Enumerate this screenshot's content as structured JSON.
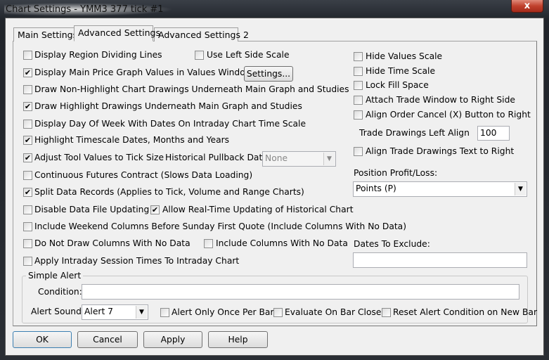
{
  "window": {
    "title": "Chart Settings - YMM3  377 tick  #1",
    "close": "x"
  },
  "tabs": [
    {
      "label": "Main Settings",
      "active": false
    },
    {
      "label": "Advanced Settings",
      "active": true
    },
    {
      "label": "Advanced Settings 2",
      "active": false
    }
  ],
  "left_options": [
    {
      "label": "Display Region Dividing Lines",
      "checked": false
    },
    {
      "label": "Display Main Price Graph Values in Values Windows",
      "checked": true
    },
    {
      "label": "Draw Non-Highlight Chart Drawings Underneath Main Graph and Studies",
      "checked": false
    },
    {
      "label": "Draw Highlight Drawings Underneath Main Graph and Studies",
      "checked": true
    },
    {
      "label": "Display Day Of Week With Dates On Intraday Chart Time Scale",
      "checked": false
    },
    {
      "label": "Highlight Timescale Dates, Months and Years",
      "checked": true
    },
    {
      "label": "Adjust Tool Values to Tick Size",
      "checked": true
    },
    {
      "label": "Continuous Futures Contract (Slows Data Loading)",
      "checked": false
    },
    {
      "label": "Split Data Records (Applies to Tick, Volume and Range Charts)",
      "checked": true
    },
    {
      "label": "Disable Data File Updating",
      "checked": false
    },
    {
      "label": "Include Weekend Columns Before Sunday First Quote (Include Columns With No Data)",
      "checked": false
    },
    {
      "label": "Do Not Draw Columns With No Data",
      "checked": false
    },
    {
      "label": "Apply Intraday Session Times To Intraday Chart",
      "checked": false
    }
  ],
  "use_left_side_scale": {
    "label": "Use Left Side Scale",
    "checked": false
  },
  "settings_button": "Settings...",
  "historical_pullback": {
    "label": "Historical Pullback Data:",
    "value": "None",
    "disabled": true
  },
  "allow_realtime": {
    "label": "Allow Real-Time Updating of Historical Chart",
    "checked": true
  },
  "include_columns": {
    "label": "Include Columns With No Data",
    "checked": false
  },
  "right_options": [
    {
      "label": "Hide Values Scale",
      "checked": false
    },
    {
      "label": "Hide Time Scale",
      "checked": false
    },
    {
      "label": "Lock Fill Space",
      "checked": false
    },
    {
      "label": "Attach Trade Window to Right Side",
      "checked": false
    },
    {
      "label": "Align Order Cancel (X) Button to Right",
      "checked": false
    }
  ],
  "trade_drawings_left_align": {
    "label": "Trade Drawings Left Align",
    "value": "100"
  },
  "align_trade_text": {
    "label": "Align Trade Drawings Text to Right",
    "checked": false
  },
  "position_pl": {
    "label": "Position Profit/Loss:",
    "value": "Points (P)"
  },
  "dates_to_exclude": {
    "label": "Dates To Exclude:",
    "value": ""
  },
  "simple_alert": {
    "title": "Simple Alert",
    "condition_label": "Condition:",
    "condition_value": "",
    "sound_label": "Alert Sound:",
    "sound_value": "Alert 7",
    "once_per_bar": {
      "label": "Alert Only Once Per Bar",
      "checked": false
    },
    "bar_close": {
      "label": "Evaluate On Bar Close",
      "checked": false
    },
    "reset": {
      "label": "Reset Alert Condition on New Bar",
      "checked": false
    }
  },
  "buttons": {
    "ok": "OK",
    "cancel": "Cancel",
    "apply": "Apply",
    "help": "Help"
  }
}
